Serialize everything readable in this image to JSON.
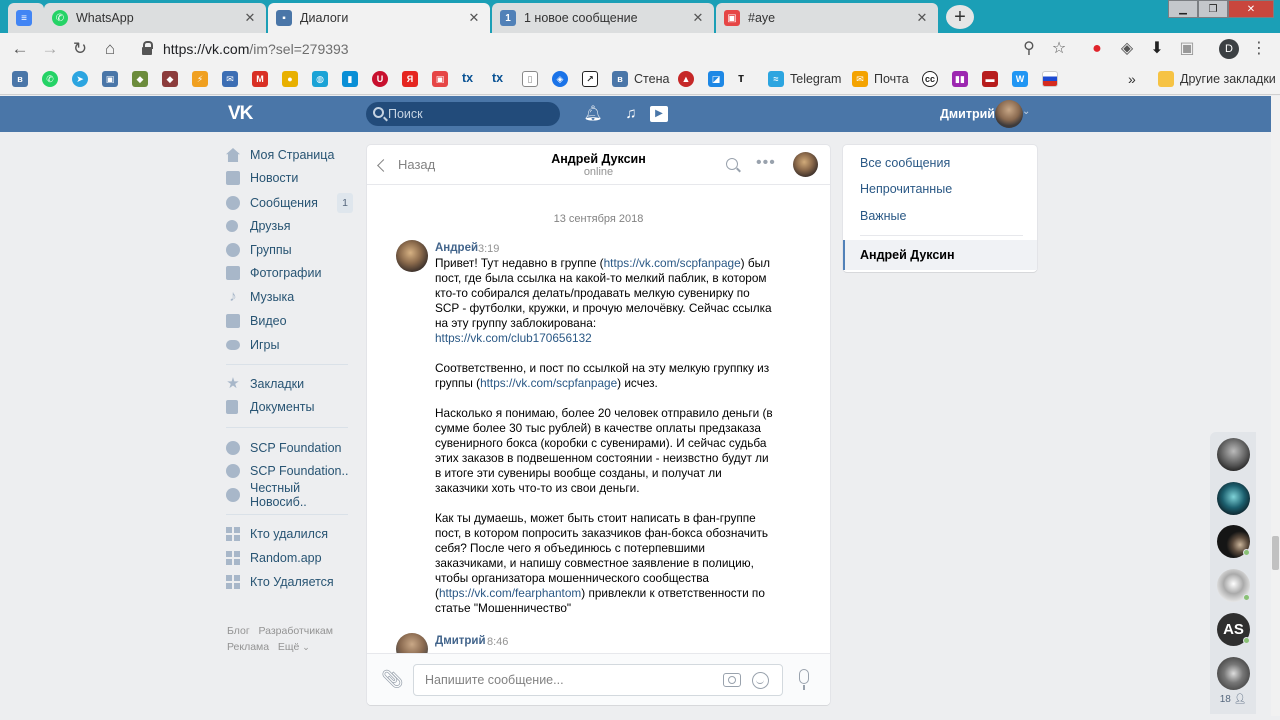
{
  "browser": {
    "tabs": [
      {
        "title": "",
        "icon": "google-docs-icon",
        "color": "#4285f4"
      },
      {
        "title": "WhatsApp",
        "icon": "whatsapp-icon",
        "color": "#25d366"
      },
      {
        "title": "Диалоги",
        "icon": "vk-messages-icon",
        "color": "#4a76a8",
        "active": true
      },
      {
        "title": "1 новое сообщение",
        "icon": "vk-counter-icon",
        "color": "#5181b8"
      },
      {
        "title": "#aye",
        "icon": "calendar-icon",
        "color": "#e64646"
      }
    ],
    "url_host": "https://vk.com",
    "url_path": "/im?sel=279393",
    "bookmarks": {
      "stena": "Стена",
      "telegram": "Telegram",
      "pochta": "Почта",
      "more": "»",
      "other": "Другие закладки"
    }
  },
  "vk": {
    "logo": "VK",
    "search_placeholder": "Поиск",
    "user_name": "Дмитрий",
    "brand_color": "#4a76a8"
  },
  "menu": {
    "items": [
      {
        "label": "Моя Страница"
      },
      {
        "label": "Новости"
      },
      {
        "label": "Сообщения",
        "badge": "1"
      },
      {
        "label": "Друзья"
      },
      {
        "label": "Группы"
      },
      {
        "label": "Фотографии"
      },
      {
        "label": "Музыка"
      },
      {
        "label": "Видео"
      },
      {
        "label": "Игры"
      },
      {
        "label": "Закладки"
      },
      {
        "label": "Документы"
      },
      {
        "label": "SCP Foundation"
      },
      {
        "label": "SCP Foundation.."
      },
      {
        "label": "Честный Новосиб.."
      },
      {
        "label": "Кто удалился"
      },
      {
        "label": "Random.app"
      },
      {
        "label": "Кто Удаляется"
      }
    ],
    "footer": {
      "blog": "Блог",
      "devs": "Разработчикам",
      "ads": "Реклама",
      "more": "Ещё"
    }
  },
  "chat": {
    "back_label": "Назад",
    "peer_name": "Андрей Дуксин",
    "peer_status": "online",
    "date": "13 сентября 2018",
    "messages": [
      {
        "author": "Андрей",
        "time": "3:19",
        "p1_a": "Привет! Тут недавно в группе (",
        "p1_link1": "https://vk.com/scpfanpage",
        "p1_b": ") был пост, где была ссылка на какой-то мелкий паблик, в котором кто-то собирался делать/продавать мелкую сувенирку по SCP - футболки, кружки, и прочую мелочёвку. Сейчас ссылка на эту группу заблокирована:",
        "p1_link2": "https://vk.com/club170656132",
        "p2_a": "Соответственно, и пост по ссылкой на эту мелкую группку из группы (",
        "p2_link": "https://vk.com/scpfanpage",
        "p2_b": ") исчез.",
        "p3": "Насколько я понимаю, более 20 человек отправило деньги (в сумме более 30 тыс рублей) в качестве оплаты предзаказа сувенирного бокса (коробки с сувенирами). И сейчас судьба этих заказов в подвешенном состоянии - неизвстно будут ли в итоге эти сувениры вообще созданы, и получат ли заказчики хоть что-то из свои деньги.",
        "p4_a": "Как ты думаешь, может быть стоит написать в фан-группе пост, в котором попросить заказчиков фан-бокса обозначить себя? После чего я объединюсь с потерпевшими заказчиками, и напишу совместное заявление в полицию, чтобы организатора мошеннического сообщества (",
        "p4_link": "https://vk.com/fearphantom",
        "p4_b": ") привлекли к ответственности по статье \"Мошенничество\""
      },
      {
        "author": "Дмитрий",
        "time": "8:46"
      }
    ],
    "composer_placeholder": "Напишите сообщение..."
  },
  "right_panel": {
    "all": "Все сообщения",
    "unread": "Непрочитанные",
    "important": "Важные",
    "active_dialog": "Андрей Дуксин"
  },
  "chatbar": {
    "count": "18"
  }
}
